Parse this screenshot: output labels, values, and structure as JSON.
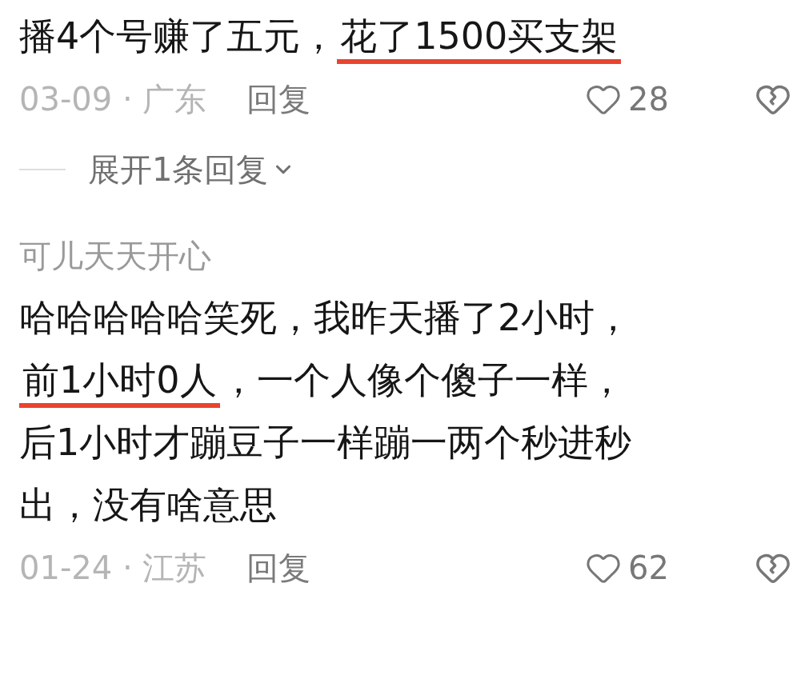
{
  "comments": [
    {
      "lines": [
        [
          {
            "text": "播4个号赚了五元，",
            "underlined": false
          },
          {
            "text": "花了1500买支架",
            "underlined": true
          }
        ]
      ],
      "date_location": "03-09 · 广东",
      "reply_label": "回复",
      "likes": "28",
      "liked": false,
      "expand_replies": "展开1条回复"
    },
    {
      "username": "可儿天天开心",
      "lines": [
        [
          {
            "text": "哈哈哈哈哈笑死，我昨天播了2小时，",
            "underlined": false
          }
        ],
        [
          {
            "text": "前1小时0人",
            "underlined": true
          },
          {
            "text": "，一个人像个傻子一样，",
            "underlined": false
          }
        ],
        [
          {
            "text": "后1小时才蹦豆子一样蹦一两个秒进秒",
            "underlined": false
          }
        ],
        [
          {
            "text": "出，没有啥意思",
            "underlined": false
          }
        ]
      ],
      "date_location": "01-24 · 江苏",
      "reply_label": "回复",
      "likes": "62",
      "liked": false
    }
  ]
}
